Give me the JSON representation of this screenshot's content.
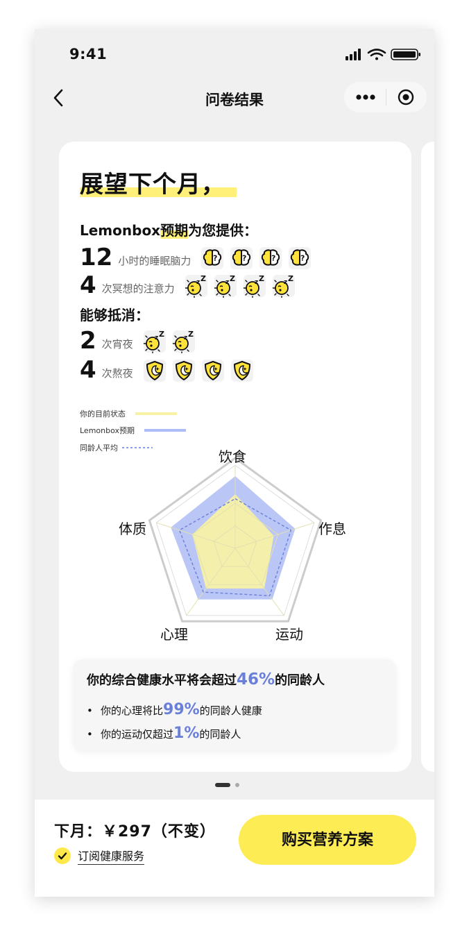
{
  "status_bar": {
    "time": "9:41"
  },
  "nav": {
    "title": "问卷结果"
  },
  "card": {
    "headline": "展望下个月，",
    "subtitle": {
      "brand": "Lemonbox",
      "highlight": "预期",
      "rest": "为您提供："
    },
    "provides": [
      {
        "value": "12",
        "unit": "小时的睡眠脑力",
        "icon": "brain-icon",
        "icon_count": 4
      },
      {
        "value": "4",
        "unit": "次冥想的注意力",
        "icon": "sleepy-face-icon",
        "icon_count": 4
      }
    ],
    "offset_title": "能够抵消：",
    "offsets": [
      {
        "value": "2",
        "unit": "次宵夜",
        "icon": "sleepy-face-icon",
        "icon_count": 2
      },
      {
        "value": "4",
        "unit": "次熬夜",
        "icon": "moon-shield-icon",
        "icon_count": 4
      }
    ],
    "legend": [
      {
        "label": "你的目前状态",
        "color": "#f7f2a6"
      },
      {
        "label": "Lemonbox预期",
        "color": "#aebcf5"
      },
      {
        "label": "同龄人平均",
        "color": "#6a7fd8"
      }
    ],
    "summary": {
      "pre": "你的综合健康水平将会超过",
      "pct": "46%",
      "post": "的同龄人",
      "bullets": [
        {
          "pre": "你的心理将比",
          "pct": "99%",
          "post": "的同龄人健康"
        },
        {
          "pre": "你的运动仅超过",
          "pct": "1%",
          "post": "的同龄人"
        }
      ]
    }
  },
  "chart_data": {
    "type": "radar",
    "axes": [
      "饮食",
      "作息",
      "运动",
      "心理",
      "体质"
    ],
    "scale_max": 10,
    "series": [
      {
        "name": "你的目前状态",
        "values": [
          6,
          4.5,
          5.5,
          5.5,
          5
        ]
      },
      {
        "name": "Lemonbox预期",
        "values": [
          8,
          7,
          7,
          7,
          7.5
        ]
      },
      {
        "name": "同龄人平均",
        "values": [
          5.5,
          6.5,
          6.5,
          6,
          6.5
        ]
      }
    ],
    "colors": {
      "current": "#f7f2a6",
      "expected": "#aebcf5",
      "average": "#6a7fd8",
      "grid": "#cccccc"
    }
  },
  "footer": {
    "price": "下月：￥297（不变）",
    "subscribe": "订阅健康服务",
    "buy": "购买营养方案"
  },
  "colors": {
    "accent_yellow": "#fdec53",
    "highlight": "#6a7fd8"
  }
}
